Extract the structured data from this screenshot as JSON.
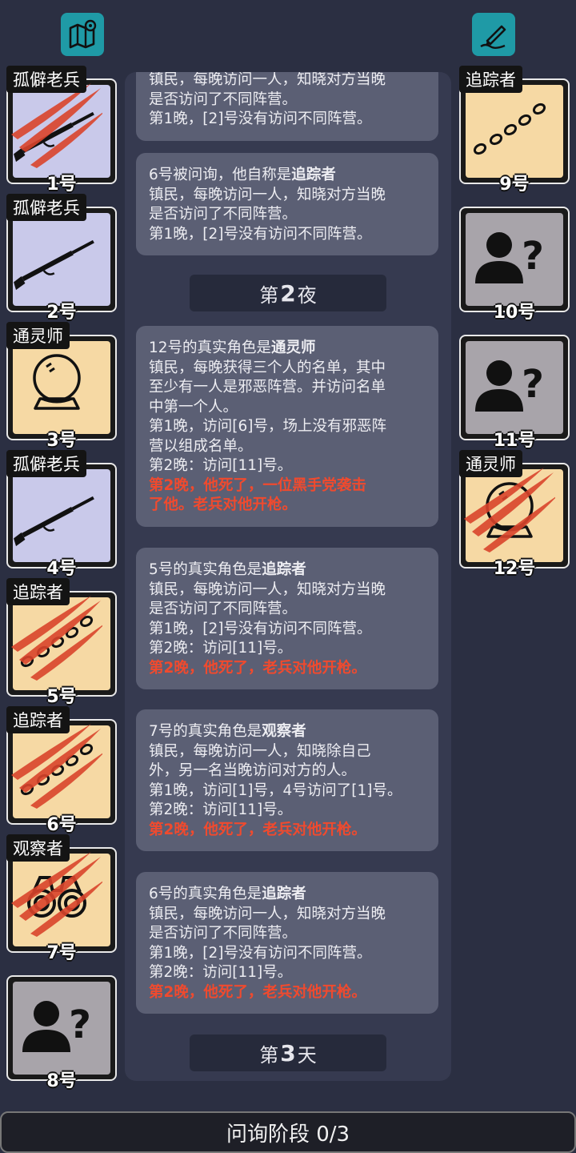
{
  "toolbar": {
    "map_icon": "map-icon",
    "notes_icon": "notes-icon"
  },
  "players_left": [
    {
      "role": "孤僻老兵",
      "number": "1号",
      "icon": "rifle-icon",
      "dead": true,
      "bg": "#c9c9ea"
    },
    {
      "role": "孤僻老兵",
      "number": "2号",
      "icon": "rifle-icon",
      "dead": false,
      "bg": "#c9c9ea"
    },
    {
      "role": "通灵师",
      "number": "3号",
      "icon": "crystal-ball-icon",
      "dead": false,
      "bg": "#f6d9a4"
    },
    {
      "role": "孤僻老兵",
      "number": "4号",
      "icon": "rifle-icon",
      "dead": false,
      "bg": "#c9c9ea"
    },
    {
      "role": "追踪者",
      "number": "5号",
      "icon": "footprints-icon",
      "dead": true,
      "bg": "#f6d9a4"
    },
    {
      "role": "追踪者",
      "number": "6号",
      "icon": "footprints-icon",
      "dead": true,
      "bg": "#f6d9a4"
    },
    {
      "role": "观察者",
      "number": "7号",
      "icon": "binoculars-icon",
      "dead": true,
      "bg": "#f6d9a4"
    },
    {
      "role": "",
      "number": "8号",
      "icon": "unknown-person-icon",
      "dead": false,
      "bg": "#a8a4aa"
    }
  ],
  "players_right": [
    {
      "role": "追踪者",
      "number": "9号",
      "icon": "footprints-icon",
      "dead": false,
      "bg": "#f6d9a4"
    },
    {
      "role": "",
      "number": "10号",
      "icon": "unknown-person-icon",
      "dead": false,
      "bg": "#a8a4aa"
    },
    {
      "role": "",
      "number": "11号",
      "icon": "unknown-person-icon",
      "dead": false,
      "bg": "#a8a4aa"
    },
    {
      "role": "通灵师",
      "number": "12号",
      "icon": "crystal-ball-icon",
      "dead": true,
      "bg": "#f6d9a4"
    }
  ],
  "log": {
    "msg0": {
      "l1": "镇民，每晚访问一人，知晓对方当晚",
      "l2": "是否访问了不同阵营。",
      "l3": "第1晚，[2]号没有访问不同阵营。"
    },
    "msg1": {
      "l1a": "6号被问询，他自称是",
      "l1b": "追踪者",
      "l2": "镇民，每晚访问一人，知晓对方当晚",
      "l3": "是否访问了不同阵营。",
      "l4": "第1晚，[2]号没有访问不同阵营。"
    },
    "phase_night": {
      "prefix": "第",
      "num": "2",
      "suffix": "夜"
    },
    "msg2": {
      "l1a": "12号的真实角色是",
      "l1b": "通灵师",
      "l2": "镇民，每晚获得三个人的名单，其中",
      "l3": "至少有一人是邪恶阵营。并访问名单",
      "l4": "中第一个人。",
      "l5": "第1晚，访问[6]号，场上没有邪恶阵",
      "l6": "营以组成名单。",
      "l7": "第2晚：访问[11]号。",
      "l8": "第2晚，他死了，一位黑手党袭击",
      "l9": "了他。老兵对他开枪。"
    },
    "msg3": {
      "l1a": "5号的真实角色是",
      "l1b": "追踪者",
      "l2": "镇民，每晚访问一人，知晓对方当晚",
      "l3": "是否访问了不同阵营。",
      "l4": "第1晚，[2]号没有访问不同阵营。",
      "l5": "第2晚：访问[11]号。",
      "l6": "第2晚，他死了，老兵对他开枪。"
    },
    "msg4": {
      "l1a": "7号的真实角色是",
      "l1b": "观察者",
      "l2": "镇民，每晚访问一人，知晓除自己",
      "l3": "外，另一名当晚访问对方的人。",
      "l4": "第1晚，访问[1]号，4号访问了[1]号。",
      "l5": "第2晚：访问[11]号。",
      "l6": "第2晚，他死了，老兵对他开枪。"
    },
    "msg5": {
      "l1a": "6号的真实角色是",
      "l1b": "追踪者",
      "l2": "镇民，每晚访问一人，知晓对方当晚",
      "l3": "是否访问了不同阵营。",
      "l4": "第1晚，[2]号没有访问不同阵营。",
      "l5": "第2晚：访问[11]号。",
      "l6": "第2晚，他死了，老兵对他开枪。"
    },
    "phase_day": {
      "prefix": "第",
      "num": "3",
      "suffix": "天"
    }
  },
  "status_bar": {
    "label": "问询阶段 0/3"
  },
  "colors": {
    "accent": "#1f9aa6",
    "death_text": "#f04a2e",
    "town_card": "#f6d9a4",
    "veteran_card": "#c9c9ea",
    "unknown_card": "#a8a4aa",
    "claw": "#d9442b"
  }
}
